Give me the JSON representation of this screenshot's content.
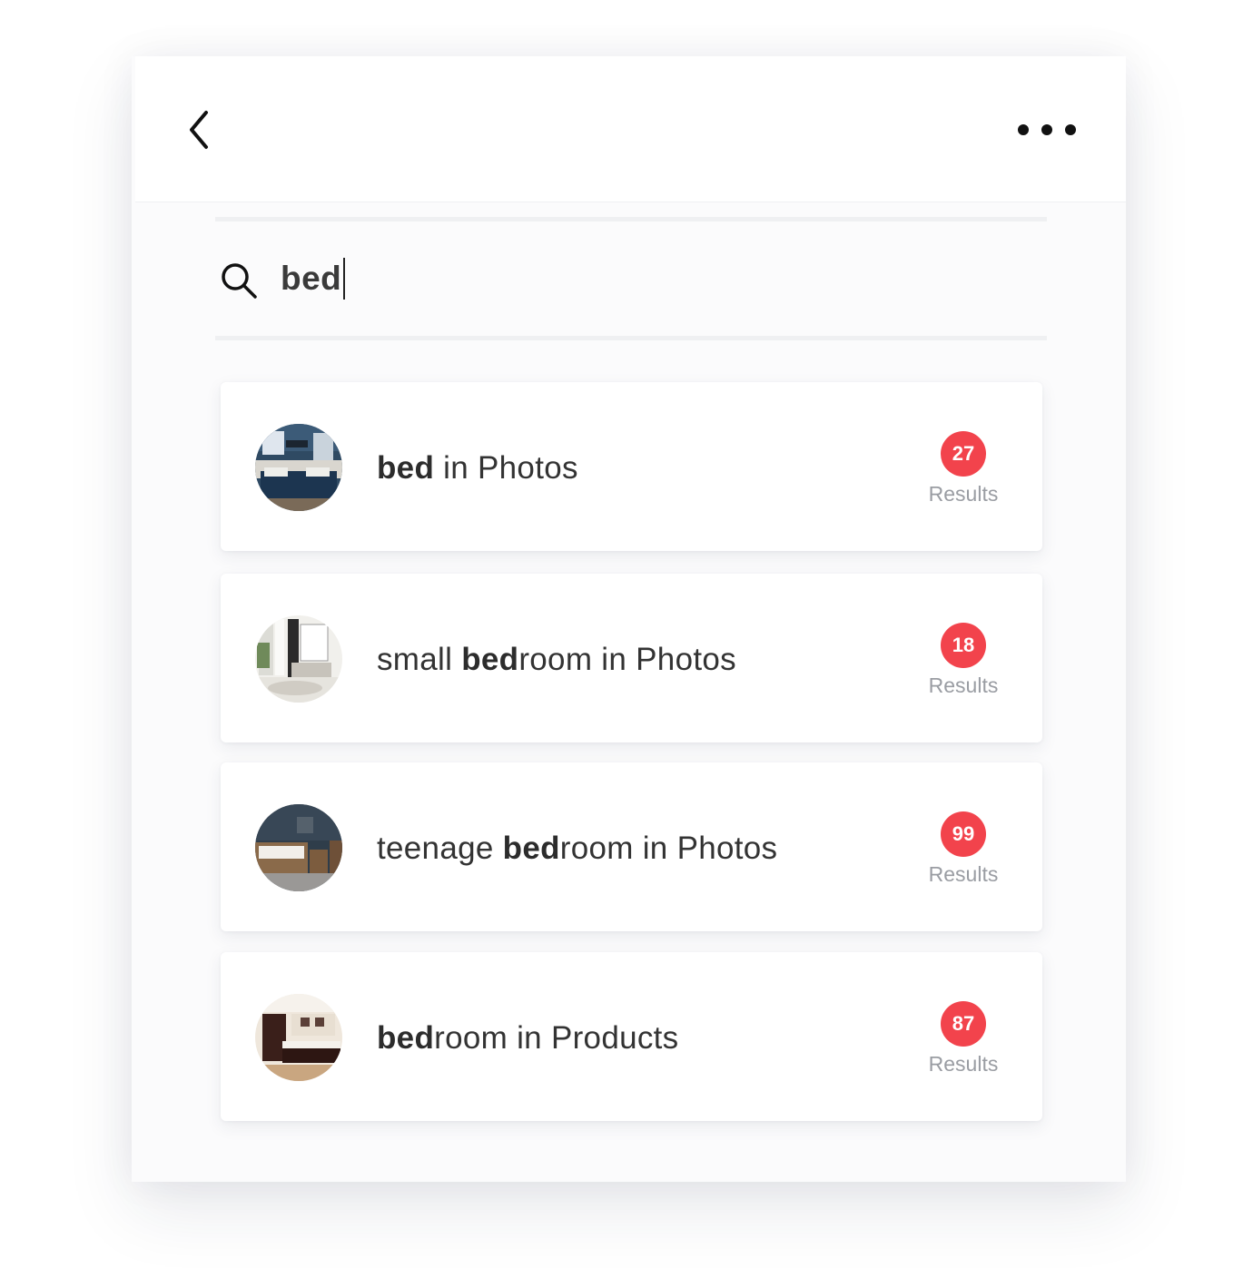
{
  "search": {
    "query": "bed"
  },
  "icons": {
    "back": "chevron-left-icon",
    "more": "more-horizontal-icon",
    "search": "search-icon"
  },
  "colors": {
    "badge": "#f2434c",
    "text": "#333333",
    "muted": "#9a9da3"
  },
  "results": [
    {
      "pre": "",
      "match": "bed",
      "post": " in Photos",
      "count": "27",
      "count_label": "Results"
    },
    {
      "pre": "small ",
      "match": "bed",
      "post": "room in Photos",
      "count": "18",
      "count_label": "Results"
    },
    {
      "pre": "teenage ",
      "match": "bed",
      "post": "room in Photos",
      "count": "99",
      "count_label": "Results"
    },
    {
      "pre": "",
      "match": "bed",
      "post": "room in Products",
      "count": "87",
      "count_label": "Results"
    }
  ]
}
